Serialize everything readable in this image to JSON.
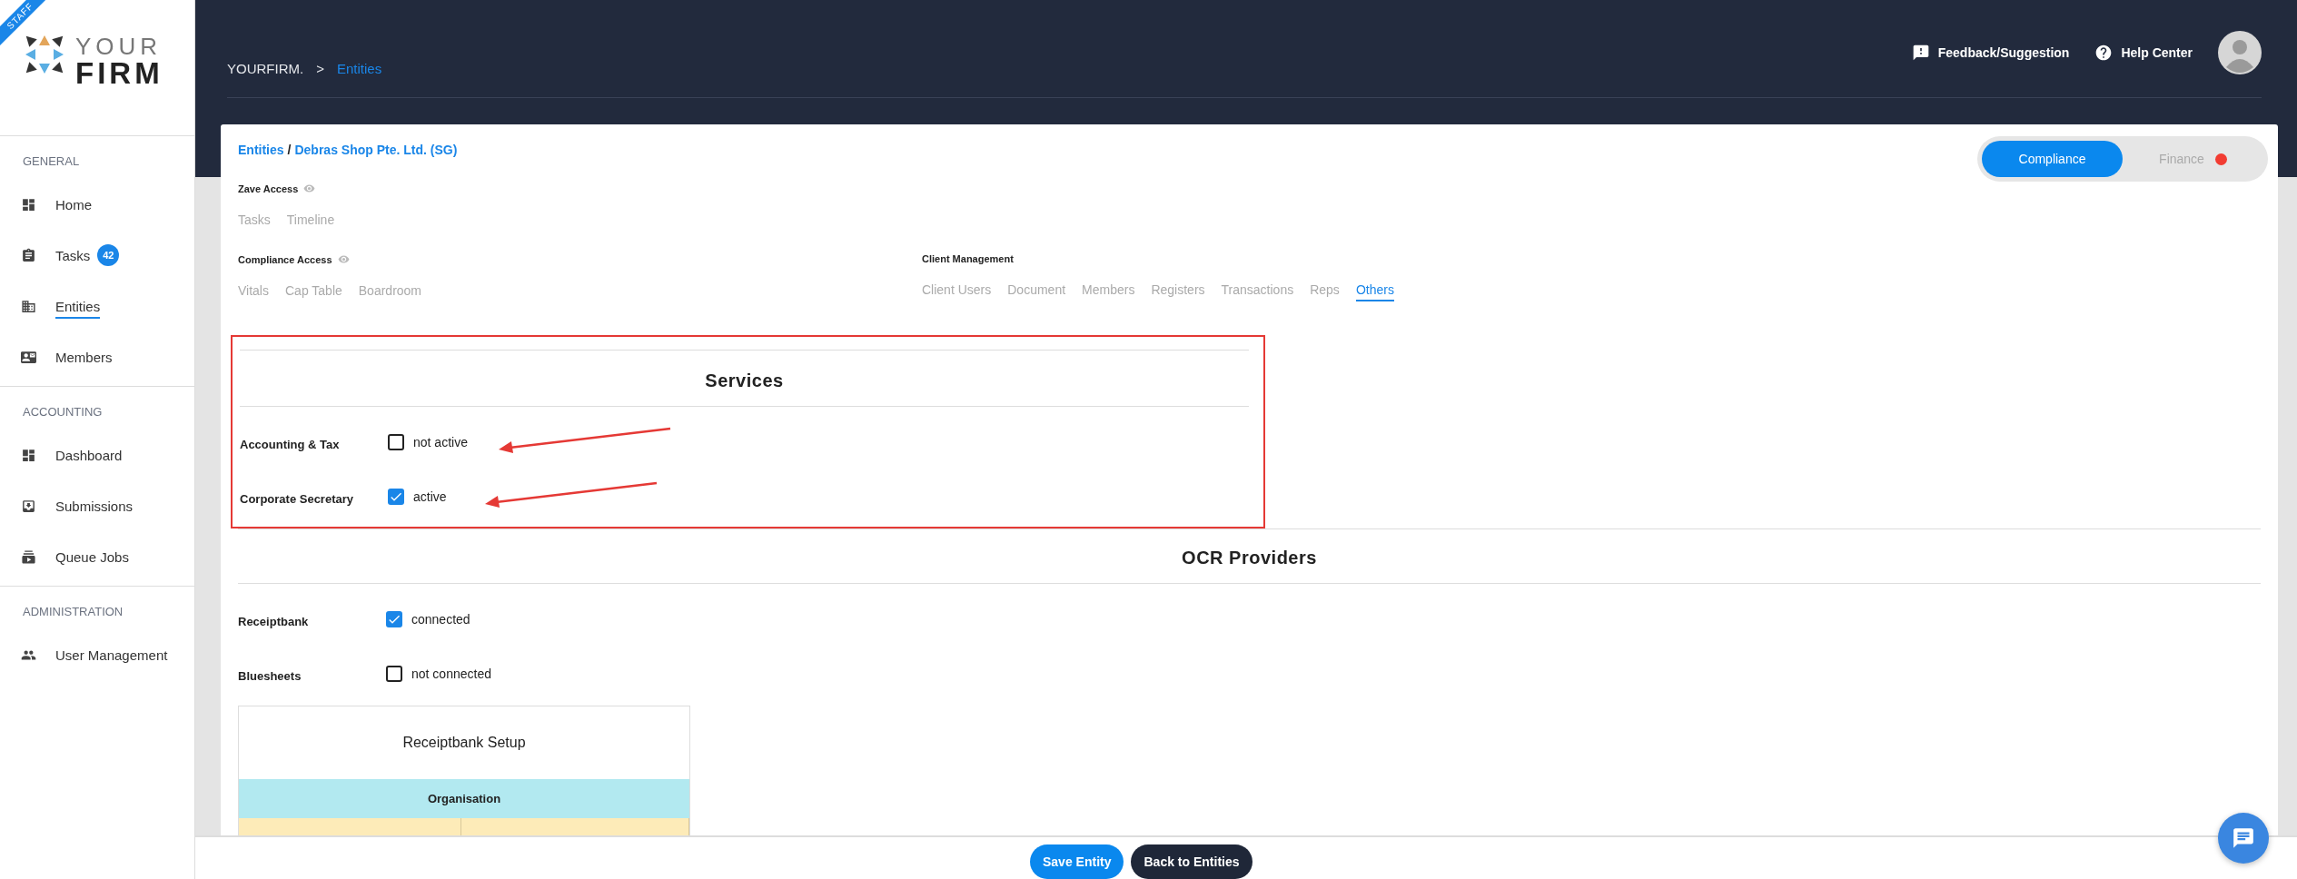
{
  "sidebar": {
    "ribbon": "STAFF",
    "logo": {
      "top": "YOUR",
      "bottom": "FIRM"
    },
    "sections": [
      {
        "heading": "GENERAL",
        "items": [
          {
            "label": "Home",
            "selected": false
          },
          {
            "label": "Tasks",
            "selected": false,
            "count": "42"
          },
          {
            "label": "Entities",
            "selected": true
          },
          {
            "label": "Members",
            "selected": false
          }
        ]
      },
      {
        "heading": "ACCOUNTING",
        "items": [
          {
            "label": "Dashboard",
            "selected": false
          },
          {
            "label": "Submissions",
            "selected": false
          },
          {
            "label": "Queue Jobs",
            "selected": false
          }
        ]
      },
      {
        "heading": "ADMINISTRATION",
        "items": [
          {
            "label": "User Management",
            "selected": false
          }
        ]
      }
    ]
  },
  "header": {
    "breadcrumb": {
      "root": "YOURFIRM.",
      "separator": ">",
      "current": "Entities"
    },
    "actions": [
      "Feedback/Suggestion",
      "Help Center"
    ]
  },
  "card": {
    "breadcrumb": {
      "parent": "Entities",
      "separator": "/",
      "current": "Debras Shop Pte. Ltd. (SG)"
    },
    "mode_toggle": [
      {
        "label": "Compliance",
        "selected": true,
        "alert": false
      },
      {
        "label": "Finance",
        "selected": false,
        "alert": true
      }
    ],
    "access_rows": [
      {
        "groups": [
          {
            "title": "Zave Access",
            "visible_icon": true,
            "tabs": [
              {
                "label": "Tasks",
                "selected": false
              },
              {
                "label": "Timeline",
                "selected": false
              }
            ]
          }
        ]
      },
      {
        "groups": [
          {
            "title": "Compliance Access",
            "visible_icon": true,
            "tabs": [
              {
                "label": "Vitals",
                "selected": false
              },
              {
                "label": "Cap Table",
                "selected": false
              },
              {
                "label": "Boardroom",
                "selected": false
              }
            ]
          },
          {
            "title": "Client Management",
            "visible_icon": false,
            "tabs": [
              {
                "label": "Client Users",
                "selected": false
              },
              {
                "label": "Document",
                "selected": false
              },
              {
                "label": "Members",
                "selected": false
              },
              {
                "label": "Registers",
                "selected": false
              },
              {
                "label": "Transactions",
                "selected": false
              },
              {
                "label": "Reps",
                "selected": false
              },
              {
                "label": "Others",
                "selected": true
              }
            ]
          }
        ]
      }
    ],
    "services": {
      "title": "Services",
      "highlighted": true,
      "rows": [
        {
          "label": "Accounting & Tax",
          "checked": false,
          "status": "not active",
          "arrow": true
        },
        {
          "label": "Corporate Secretary",
          "checked": true,
          "status": "active",
          "arrow": true
        }
      ]
    },
    "ocr": {
      "title": "OCR Providers",
      "rows": [
        {
          "label": "Receiptbank",
          "checked": true,
          "status": "connected"
        },
        {
          "label": "Bluesheets",
          "checked": false,
          "status": "not connected"
        }
      ]
    },
    "setup": {
      "title": "Receiptbank Setup",
      "header": "Organisation"
    }
  },
  "footer": {
    "buttons": [
      {
        "label": "Save Entity",
        "kind": "primary"
      },
      {
        "label": "Back to Entities",
        "kind": "secondary"
      }
    ]
  }
}
